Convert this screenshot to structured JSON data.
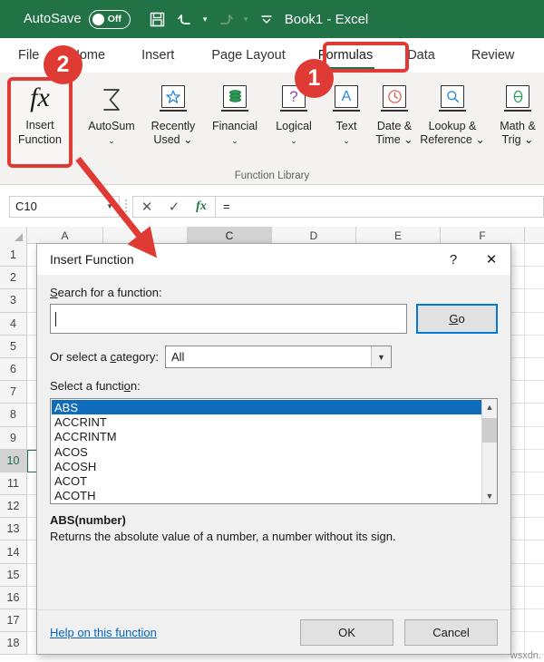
{
  "titlebar": {
    "autosave_label": "AutoSave",
    "autosave_state": "Off",
    "save_icon": "save-icon",
    "undo_icon": "undo-icon",
    "redo_icon": "redo-icon",
    "customize_icon": "customize-quick-access-toolbar-icon",
    "document_title": "Book1  -  Excel"
  },
  "tabs": [
    {
      "label": "File",
      "active": false
    },
    {
      "label": "Home",
      "active": false
    },
    {
      "label": "Insert",
      "active": false
    },
    {
      "label": "Page Layout",
      "active": false
    },
    {
      "label": "Formulas",
      "active": true
    },
    {
      "label": "Data",
      "active": false
    },
    {
      "label": "Review",
      "active": false
    }
  ],
  "ribbon": {
    "group_label": "Function Library",
    "insert_function": {
      "line1": "Insert",
      "line2": "Function",
      "icon": "fx-icon"
    },
    "buttons": [
      {
        "line1": "AutoSum",
        "line2": "⌄",
        "icon": "sigma-icon"
      },
      {
        "line1": "Recently",
        "line2": "Used ⌄",
        "icon": "star-book-icon"
      },
      {
        "line1": "Financial",
        "line2": "⌄",
        "icon": "coins-book-icon"
      },
      {
        "line1": "Logical",
        "line2": "⌄",
        "icon": "question-book-icon"
      },
      {
        "line1": "Text",
        "line2": "⌄",
        "icon": "letter-a-book-icon"
      },
      {
        "line1": "Date &",
        "line2": "Time ⌄",
        "icon": "clock-book-icon"
      },
      {
        "line1": "Lookup &",
        "line2": "Reference ⌄",
        "icon": "magnifier-book-icon"
      },
      {
        "line1": "Math &",
        "line2": "Trig ⌄",
        "icon": "theta-book-icon"
      }
    ]
  },
  "formula_bar": {
    "name_box_value": "C10",
    "cancel_icon": "cancel-x-icon",
    "enter_icon": "enter-check-icon",
    "insert_function_icon": "fx-icon",
    "formula_value": "="
  },
  "grid": {
    "columns": [
      "A",
      "B",
      "C",
      "D",
      "E",
      "F"
    ],
    "selected_column": "C",
    "rows": [
      "1",
      "2",
      "3",
      "4",
      "5",
      "6",
      "7",
      "8",
      "9",
      "10",
      "11",
      "12",
      "13",
      "14",
      "15",
      "16",
      "17",
      "18"
    ],
    "selected_row": "10",
    "active_cell": "C10"
  },
  "dialog": {
    "title": "Insert Function",
    "help_ctrl": "?",
    "close_ctrl": "✕",
    "search_label_pre": "",
    "search_label_accel": "S",
    "search_label_post": "earch for a function:",
    "search_value": "",
    "go_label_accel": "G",
    "go_label_post": "o",
    "category_label_pre": "Or select a ",
    "category_label_accel": "c",
    "category_label_post": "ategory:",
    "category_value": "All",
    "select_label_pre": "Select a functi",
    "select_label_accel": "o",
    "select_label_post": "n:",
    "functions": [
      {
        "name": "ABS",
        "selected": true
      },
      {
        "name": "ACCRINT",
        "selected": false
      },
      {
        "name": "ACCRINTM",
        "selected": false
      },
      {
        "name": "ACOS",
        "selected": false
      },
      {
        "name": "ACOSH",
        "selected": false
      },
      {
        "name": "ACOT",
        "selected": false
      },
      {
        "name": "ACOTH",
        "selected": false
      }
    ],
    "description_signature": "ABS(number)",
    "description_text": "Returns the absolute value of a number, a number without its sign.",
    "help_link": "Help on this function",
    "ok_label": "OK",
    "cancel_label": "Cancel",
    "scroll_up_icon": "chevron-up-icon",
    "scroll_down_icon": "chevron-down-icon"
  },
  "annotations": {
    "accent_color": "#e03a34",
    "badge_1": "1",
    "badge_2": "2"
  },
  "watermark": "wsxdn."
}
